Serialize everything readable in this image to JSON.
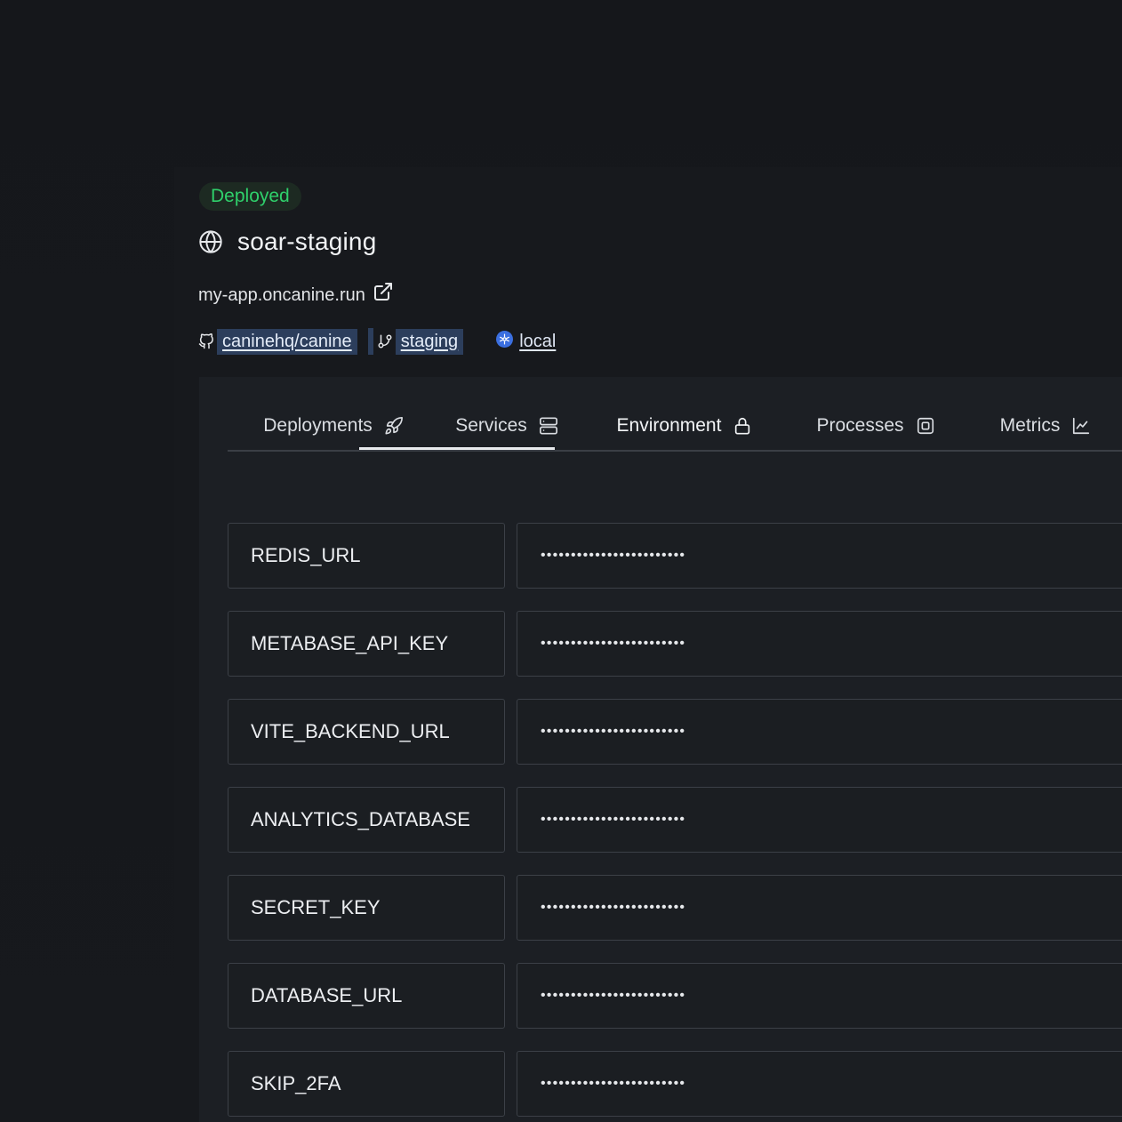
{
  "header": {
    "status": "Deployed",
    "title": "soar-staging",
    "url": "my-app.oncanine.run",
    "repo": "caninehq/canine",
    "branch": "staging",
    "cluster": "local"
  },
  "tabs": [
    {
      "label": "Deployments",
      "icon": "rocket-icon",
      "active": false
    },
    {
      "label": "Services",
      "icon": "server-icon",
      "active": false
    },
    {
      "label": "Environment",
      "icon": "lock-icon",
      "active": true
    },
    {
      "label": "Processes",
      "icon": "cpu-icon",
      "active": false
    },
    {
      "label": "Metrics",
      "icon": "chart-icon",
      "active": false
    }
  ],
  "env_vars": [
    {
      "key": "REDIS_URL",
      "value": "••••••••••••••••••••••••"
    },
    {
      "key": "METABASE_API_KEY",
      "value": "••••••••••••••••••••••••"
    },
    {
      "key": "VITE_BACKEND_URL",
      "value": "••••••••••••••••••••••••"
    },
    {
      "key": "ANALYTICS_DATABASE",
      "value": "••••••••••••••••••••••••"
    },
    {
      "key": "SECRET_KEY",
      "value": "••••••••••••••••••••••••"
    },
    {
      "key": "DATABASE_URL",
      "value": "••••••••••••••••••••••••"
    },
    {
      "key": "SKIP_2FA",
      "value": "••••••••••••••••••••••••"
    }
  ],
  "colors": {
    "background": "#16181c",
    "card": "#1c1f24",
    "status_green": "#2fd06b",
    "link_highlight": "#2c3e5c",
    "k8s_blue": "#3b6fe0"
  }
}
